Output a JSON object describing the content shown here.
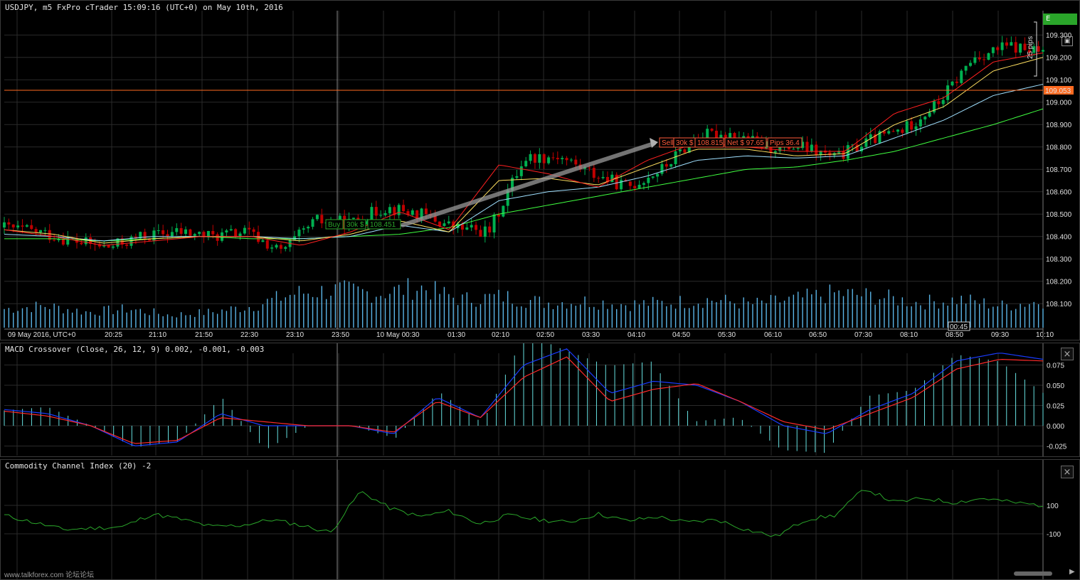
{
  "window": {
    "title": "USDJPY, m5 FxPro cTrader 15:09:16 (UTC+0) on May 10th, 2016",
    "symbol": "USDJPY",
    "timeframe": "m5",
    "platform": "FxPro cTrader",
    "current_price": "109.053"
  },
  "price_axis": {
    "ticks": [
      "109.300",
      "109.200",
      "109.100",
      "109.000",
      "108.900",
      "108.800",
      "108.700",
      "108.600",
      "108.500",
      "108.400",
      "108.300",
      "108.200",
      "108.100"
    ]
  },
  "time_axis": {
    "labels": [
      "09 May 2016, UTC+0",
      "20:25",
      "21:10",
      "21:50",
      "22:30",
      "23:10",
      "23:50",
      "10 May 00:30",
      "01:30",
      "02:10",
      "02:50",
      "03:30",
      "04:10",
      "04:50",
      "05:30",
      "06:10",
      "06:50",
      "07:30",
      "08:10",
      "08:50",
      "09:30",
      "10:10"
    ],
    "cursor_label": "00:45"
  },
  "trade": {
    "buy": {
      "side": "Buy",
      "volume": "30k $",
      "price": "108.451"
    },
    "sell": {
      "side": "Sell",
      "volume": "30k $",
      "price": "108.815",
      "net": "Net $ 97.65",
      "pips": "Pips 36.4"
    }
  },
  "ruler": {
    "label": "25 pips"
  },
  "corner": {
    "mode_label": "E"
  },
  "macd": {
    "title": "MACD Crossover (Close, 26, 12, 9) 0.002, -0.001, -0.003",
    "ticks": [
      "0.075",
      "0.050",
      "0.025",
      "0.000",
      "-0.025"
    ],
    "close_icon": "×"
  },
  "cci": {
    "title": "Commodity Channel Index (20) -2",
    "ticks": [
      "100",
      "-100"
    ],
    "close_icon": "×"
  },
  "footer": {
    "watermark": "www.talkforex.com 论坛论坛"
  },
  "colors": {
    "bull_candle": "#00b050",
    "bear_candle": "#c00000",
    "volume": "#5ab4e6",
    "ema_fast": "#ff2020",
    "ema_mid": "#ffe060",
    "ema_slow": "#a0e0ff",
    "ema_slowest": "#40ff40",
    "macd_line": "#1a3cff",
    "signal_line": "#ff2a2a",
    "macd_hist": "#66e0e0",
    "cci_line": "#2aa52a",
    "current_price_bg": "#ff6a20",
    "buy_tag": "#2aa52a",
    "sell_tag": "#ff5a3a",
    "grid": "#2a2a2a"
  },
  "chart_data": {
    "type": "candlestick",
    "price_ticks": [
      109.3,
      109.2,
      109.1,
      109.0,
      108.9,
      108.8,
      108.7,
      108.6,
      108.5,
      108.4,
      108.3,
      108.2,
      108.1
    ],
    "current_price": 109.053,
    "buy_price": 108.451,
    "sell_price": 108.815,
    "macd_ticks": [
      0.075,
      0.05,
      0.025,
      0.0,
      -0.025
    ],
    "cci_ticks": [
      100,
      -100
    ],
    "x": [
      "09 May 2016, UTC+0",
      "20:25",
      "21:10",
      "21:50",
      "22:30",
      "23:10",
      "23:50",
      "10 May 00:30",
      "01:30",
      "02:10",
      "02:50",
      "03:30",
      "04:10",
      "04:50",
      "05:30",
      "06:10",
      "06:50",
      "07:30",
      "08:10",
      "08:50",
      "09:30",
      "10:10"
    ],
    "close_anchors": [
      108.44,
      108.42,
      108.38,
      108.35,
      108.4,
      108.42,
      108.4,
      108.42,
      108.33,
      108.47,
      108.46,
      108.53,
      108.5,
      108.44,
      108.42,
      108.75,
      108.76,
      108.68,
      108.62,
      108.7,
      108.85,
      108.86,
      108.8,
      108.8,
      108.75,
      108.83,
      108.88,
      109.0,
      109.2,
      109.25,
      109.22
    ],
    "ema_anchors": {
      "fast": [
        108.43,
        108.4,
        108.36,
        108.38,
        108.4,
        108.4,
        108.36,
        108.42,
        108.51,
        108.43,
        108.72,
        108.68,
        108.62,
        108.74,
        108.82,
        108.8,
        108.78,
        108.78,
        108.95,
        109.02,
        109.18,
        109.22
      ],
      "mid": [
        108.43,
        108.41,
        108.37,
        108.39,
        108.4,
        108.4,
        108.38,
        108.41,
        108.47,
        108.42,
        108.65,
        108.66,
        108.63,
        108.71,
        108.79,
        108.79,
        108.76,
        108.77,
        108.9,
        108.98,
        109.14,
        109.2
      ],
      "slow": [
        108.41,
        108.4,
        108.38,
        108.4,
        108.4,
        108.4,
        108.39,
        108.4,
        108.45,
        108.42,
        108.56,
        108.6,
        108.62,
        108.67,
        108.74,
        108.76,
        108.75,
        108.76,
        108.84,
        108.92,
        109.03,
        109.08
      ],
      "slowest": [
        108.39,
        108.39,
        108.38,
        108.39,
        108.4,
        108.39,
        108.39,
        108.4,
        108.41,
        108.44,
        108.5,
        108.54,
        108.58,
        108.62,
        108.66,
        108.7,
        108.71,
        108.74,
        108.78,
        108.84,
        108.9,
        108.97
      ]
    },
    "volume_anchors": [
      12,
      14,
      10,
      12,
      8,
      10,
      14,
      22,
      24,
      22,
      26,
      18,
      20,
      16,
      17,
      15,
      16,
      18,
      15,
      18,
      22,
      20,
      16,
      18,
      14,
      17
    ],
    "macd_anchors": [
      0.02,
      0.015,
      0.0,
      -0.025,
      -0.02,
      0.015,
      0.0,
      0.0,
      0.0,
      -0.01,
      0.035,
      0.01,
      0.075,
      0.095,
      0.04,
      0.055,
      0.05,
      0.03,
      0.0,
      -0.01,
      0.02,
      0.04,
      0.08,
      0.09,
      0.082
    ],
    "signal_anchors": [
      0.018,
      0.012,
      0.0,
      -0.022,
      -0.018,
      0.01,
      0.005,
      0.0,
      0.0,
      -0.008,
      0.03,
      0.01,
      0.06,
      0.085,
      0.03,
      0.045,
      0.052,
      0.03,
      0.005,
      -0.005,
      0.015,
      0.035,
      0.07,
      0.082,
      0.08
    ],
    "cci_anchors": [
      30,
      -20,
      -70,
      -60,
      -50,
      40,
      0,
      -50,
      -40,
      0,
      -40,
      -90,
      200,
      80,
      20,
      60,
      -30,
      30,
      0,
      -20,
      40,
      -10,
      20,
      -20,
      0,
      -70,
      -120,
      0,
      30,
      220,
      120,
      150,
      120,
      150,
      120,
      100
    ]
  }
}
